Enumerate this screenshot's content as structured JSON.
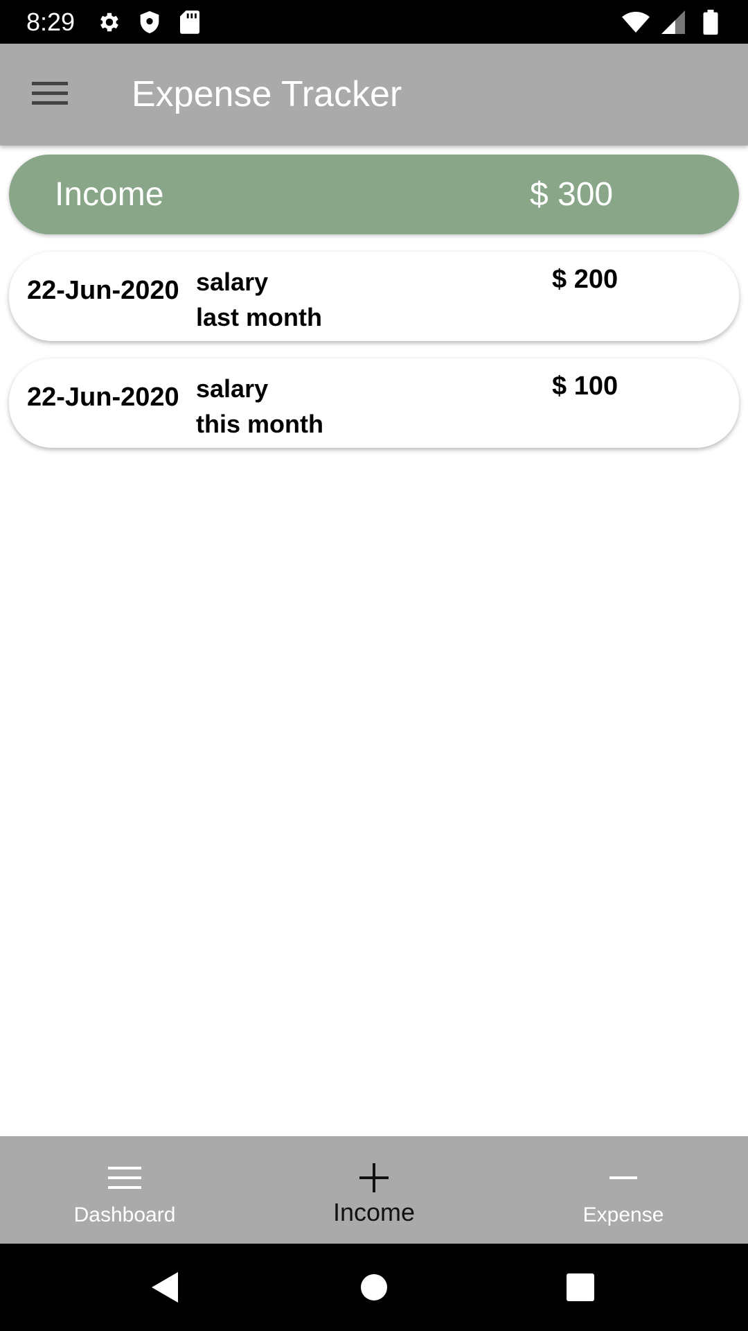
{
  "status_bar": {
    "time": "8:29",
    "icons_left": [
      "gear-icon",
      "shield-icon",
      "sd-card-icon"
    ],
    "icons_right": [
      "wifi-icon",
      "cell-signal-icon",
      "battery-icon"
    ]
  },
  "app_bar": {
    "title": "Expense Tracker",
    "menu_icon": "hamburger-menu-icon"
  },
  "summary": {
    "label": "Income",
    "total": "$ 300",
    "color": "#89a689"
  },
  "entries": [
    {
      "date": "22-Jun-2020",
      "description": "salary\nlast month",
      "amount": "$ 200"
    },
    {
      "date": "22-Jun-2020",
      "description": "salary\nthis month",
      "amount": "$ 100"
    }
  ],
  "bottom_nav": {
    "items": [
      {
        "label": "Dashboard",
        "icon": "list-icon",
        "active": false
      },
      {
        "label": "Income",
        "icon": "plus-icon",
        "active": true
      },
      {
        "label": "Expense",
        "icon": "minus-icon",
        "active": false
      }
    ],
    "background": "#aaaaaa"
  },
  "system_nav": {
    "icons": [
      "back-icon",
      "home-icon",
      "recents-icon"
    ]
  }
}
